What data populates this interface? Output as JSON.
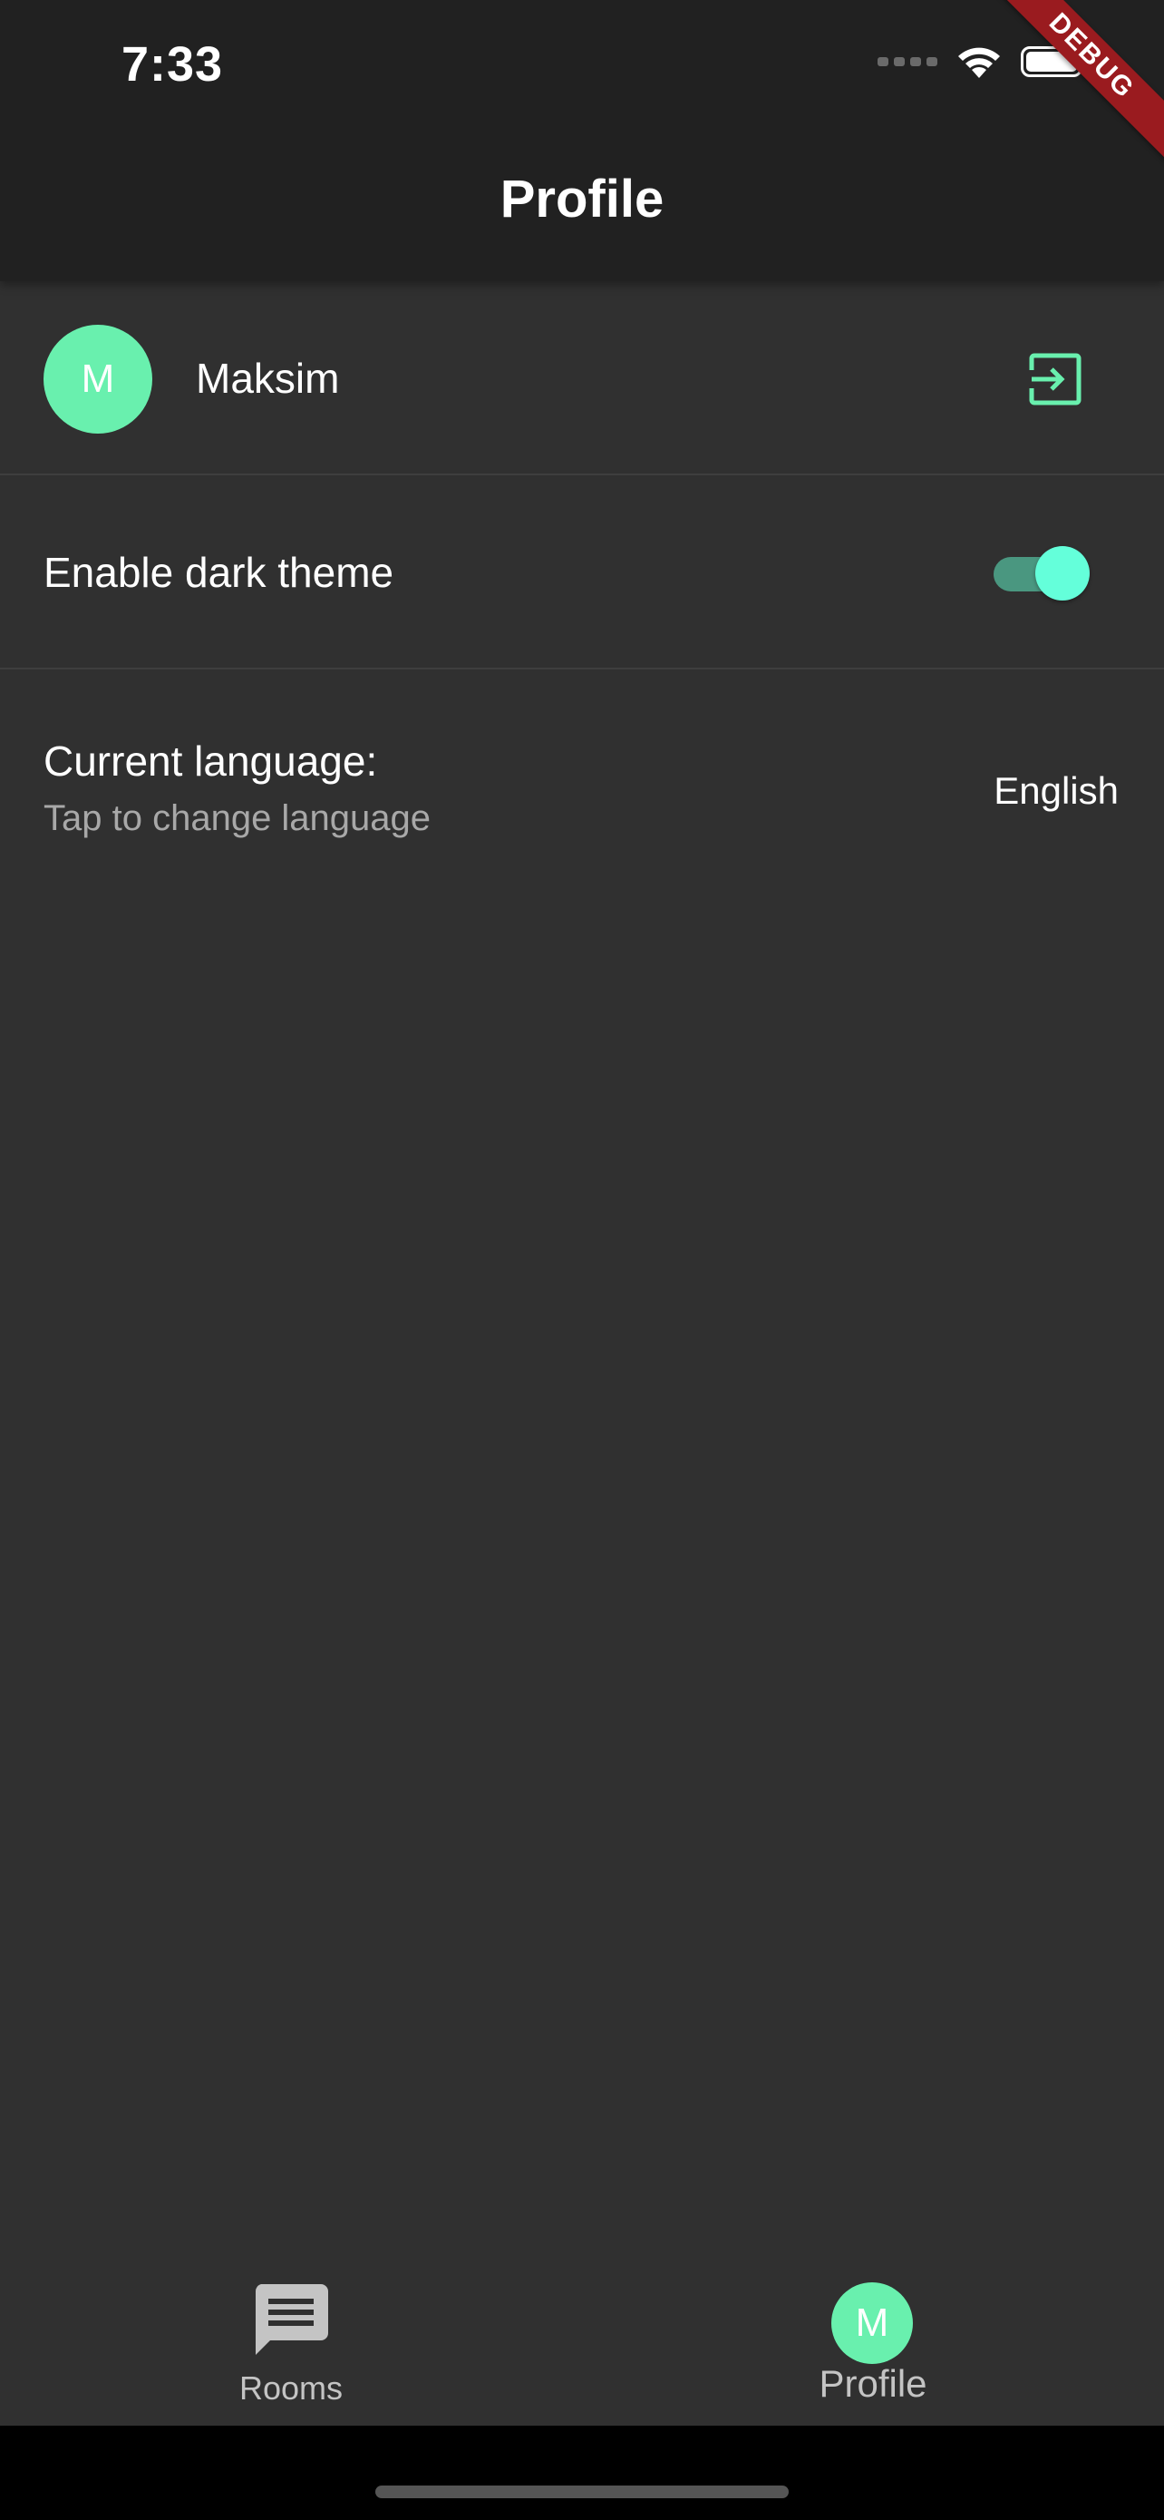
{
  "status_bar": {
    "time": "7:33"
  },
  "debug_banner": "DEBUG",
  "app_bar": {
    "title": "Profile"
  },
  "profile_row": {
    "avatar_initial": "M",
    "user_name": "Maksim",
    "action_icon": "logout-icon"
  },
  "theme_row": {
    "label": "Enable dark theme",
    "enabled": true
  },
  "language_row": {
    "title": "Current language:",
    "subtitle": "Tap to change language",
    "value": "English"
  },
  "bottom_nav": {
    "items": [
      {
        "label": "Rooms",
        "icon": "chat-icon"
      },
      {
        "label": "Profile",
        "avatar_initial": "M",
        "selected": true
      }
    ]
  },
  "colors": {
    "accent": "#69f0ae",
    "switch_thumb": "#64ffda",
    "app_bar": "#212121",
    "background": "#303030",
    "debug_ribbon": "#9a1b1f"
  }
}
